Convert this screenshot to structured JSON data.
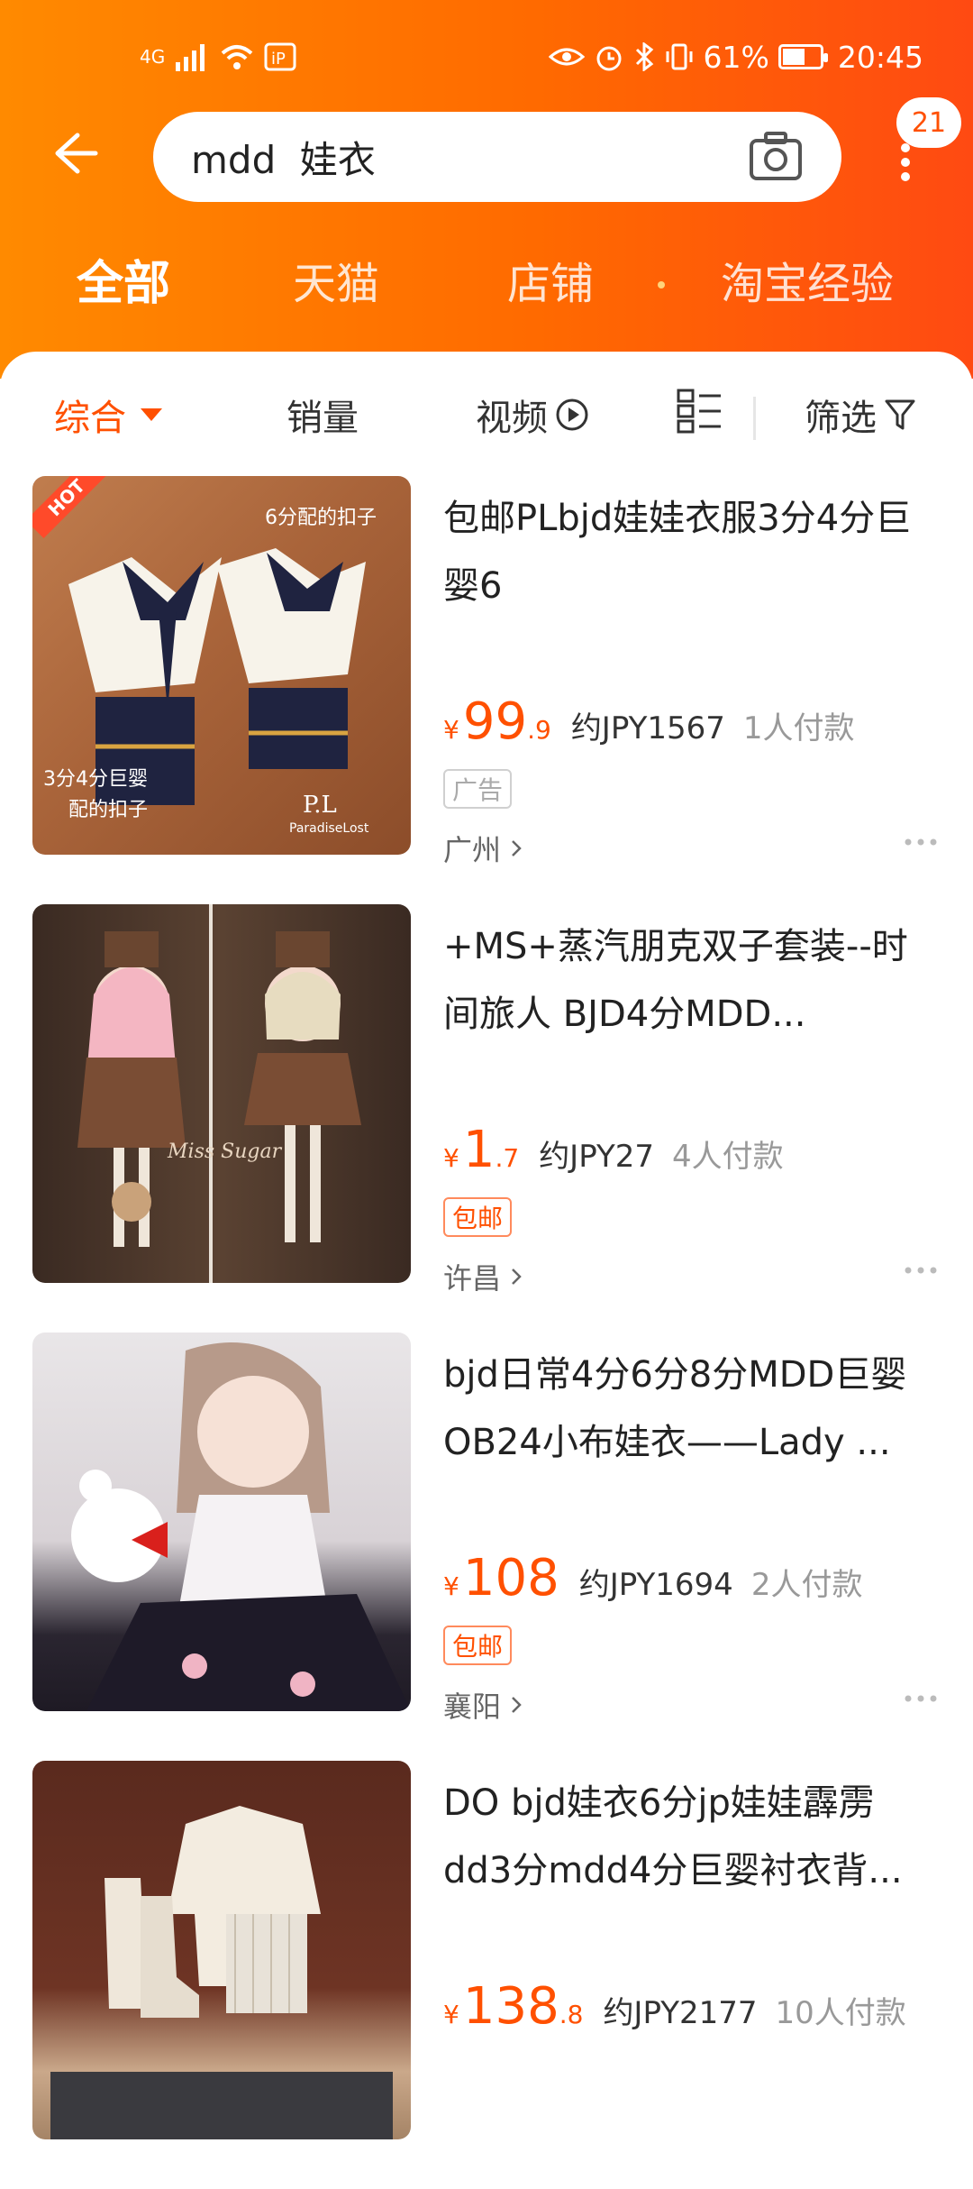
{
  "status_bar": {
    "signal": "4G",
    "battery": "61%",
    "time": "20:45"
  },
  "search": {
    "query": "mdd  娃衣",
    "badge_count": "21"
  },
  "tabs": [
    {
      "label": "全部"
    },
    {
      "label": "天猫"
    },
    {
      "label": "店铺"
    },
    {
      "label": "淘宝经验"
    }
  ],
  "sort": {
    "comprehensive": "综合",
    "sales": "销量",
    "video": "视频",
    "filter": "筛选"
  },
  "items": [
    {
      "title": "包邮PLbjd娃娃衣服3分4分巨婴6",
      "price_int": "99",
      "price_dec": ".9",
      "jpy": "约JPY1567",
      "sold": "1人付款",
      "tag": "广告",
      "location": "广州",
      "thumb_text_1": "6分配的扣子",
      "thumb_text_2": "3分4分巨婴",
      "thumb_text_3": "配的扣子",
      "thumb_brand": "P.L",
      "thumb_brand_sub": "ParadiseLost",
      "hot": "HOT"
    },
    {
      "title": "+MS+蒸汽朋克双子套装--时间旅人 BJD4分MDD...",
      "price_int": "1",
      "price_dec": ".7",
      "jpy": "约JPY27",
      "sold": "4人付款",
      "tag": "包邮",
      "location": "许昌",
      "thumb_text_1": "Miss Sugar"
    },
    {
      "title": "bjd日常4分6分8分MDD巨婴OB24小布娃衣——Lady ...",
      "price_int": "108",
      "price_dec": "",
      "jpy": "约JPY1694",
      "sold": "2人付款",
      "tag": "包邮",
      "location": "襄阳"
    },
    {
      "title": "DO bjd娃衣6分jp娃娃霹雳dd3分mdd4分巨婴衬衣背...",
      "price_int": "138",
      "price_dec": ".8",
      "jpy": "约JPY2177",
      "sold": "10人付款"
    }
  ]
}
